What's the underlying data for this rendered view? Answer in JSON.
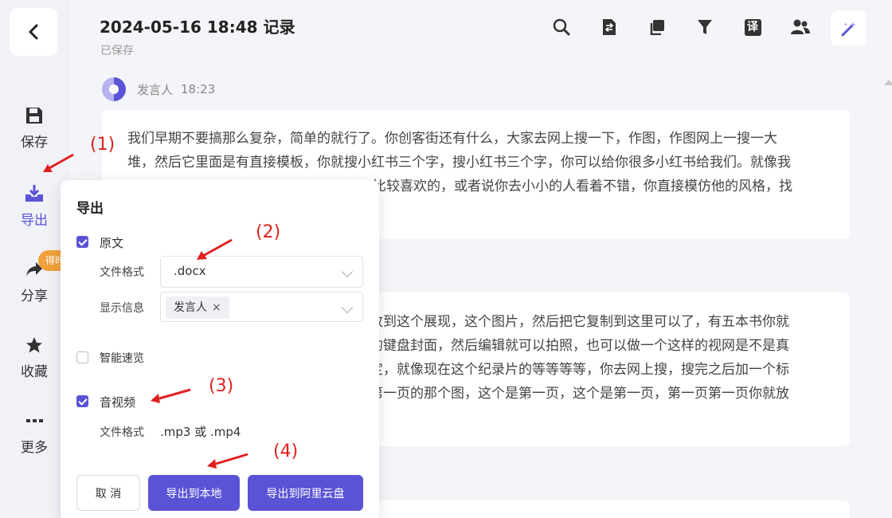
{
  "header": {
    "title": "2024-05-16 18:48 记录",
    "saved_status": "已保存"
  },
  "sidebar": {
    "items": [
      {
        "label": "保存",
        "icon": "save-icon"
      },
      {
        "label": "导出",
        "icon": "export-icon"
      },
      {
        "label": "分享",
        "icon": "share-icon"
      },
      {
        "label": "收藏",
        "icon": "star-icon"
      },
      {
        "label": "更多",
        "icon": "more-icon"
      }
    ],
    "share_badge": "得时"
  },
  "toolbar": {
    "icons": [
      "search-icon",
      "convert-doc-icon",
      "copy-icon",
      "filter-icon",
      "translate-icon",
      "speakers-icon",
      "magic-wand-icon"
    ],
    "translate_glyph": "译"
  },
  "transcript": {
    "speaker_name": "发言人",
    "speaker_time": "18:23",
    "card1_lines": [
      "我们早期不要搞那么复杂，简单的就行了。你创客街还有什么，大家去网上搜一下，作图，作图网上一搜一大",
      "堆，然后它里面是有直接模板，你就搜小红书三个字，搜小红书三个字，你可以给你很多小红书给我们。就像我",
      "比较喜欢的，或者说你去小小的人看着不错，你直接模仿他的风格，找"
    ],
    "card2_lines": [
      "放到这个展现，这个图片，然后把它复制到这里可以了，有五本书你就",
      "的键盘封面，然后编辑就可以拍照，也可以做一个这样的视网是不是真",
      "定，就像现在这个纪录片的等等等等，你去网上搜，搜完之后加一个标",
      "第一页的那个图，这个是第一页，这个是第一页，第一页第一页你就放"
    ]
  },
  "export_panel": {
    "title": "导出",
    "original": {
      "label": "原文",
      "checked": true
    },
    "file_format_label": "文件格式",
    "file_format_value": ".docx",
    "display_info_label": "显示信息",
    "display_info_tag": "发言人",
    "tag_close": "×",
    "smart_preview": {
      "label": "智能速览",
      "checked": false
    },
    "audio_video": {
      "label": "音视频",
      "checked": true
    },
    "av_format_label": "文件格式",
    "av_format_value": ".mp3 或 .mp4",
    "cancel_label": "取 消",
    "export_local_label": "导出到本地",
    "export_cloud_label": "导出到阿里云盘"
  },
  "annotations": [
    "(1)",
    "(2)",
    "(3)",
    "(4)"
  ],
  "colors": {
    "accent": "#5b53d6",
    "annotation": "#e02020",
    "badge": "#f0a13a"
  }
}
